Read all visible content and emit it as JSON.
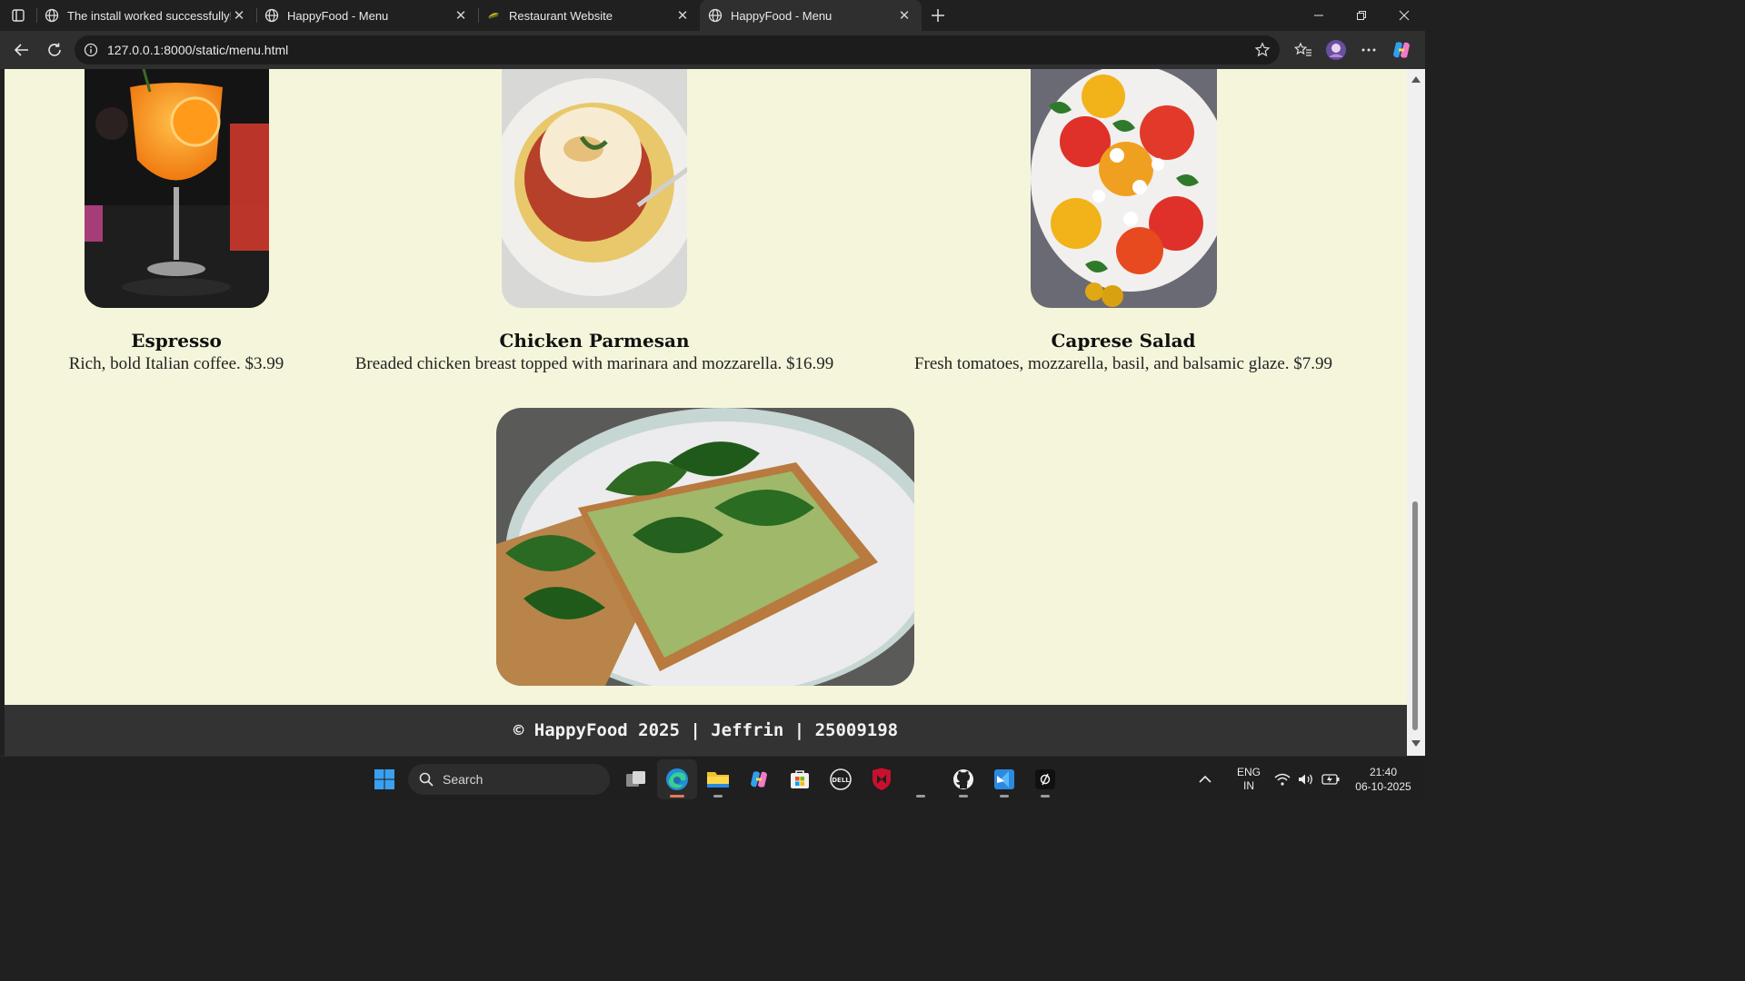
{
  "browser": {
    "tabs": [
      {
        "title": "The install worked successfully! C"
      },
      {
        "title": "HappyFood - Menu"
      },
      {
        "title": "Restaurant Website"
      },
      {
        "title": "HappyFood - Menu"
      }
    ],
    "url": "127.0.0.1:8000/static/menu.html"
  },
  "menu": {
    "items": [
      {
        "name": "Espresso",
        "description": "Rich, bold Italian coffee. $3.99"
      },
      {
        "name": "Chicken Parmesan",
        "description": "Breaded chicken breast topped with marinara and mozzarella. $16.99"
      },
      {
        "name": "Caprese Salad",
        "description": "Fresh tomatoes, mozzarella, basil, and balsamic glaze. $7.99"
      }
    ]
  },
  "footer": {
    "text": "© HappyFood 2025 | Jeffrin | 25009198"
  },
  "taskbar": {
    "search_placeholder": "Search",
    "language": "ENG",
    "region": "IN",
    "time": "21:40",
    "date": "06-10-2025"
  }
}
